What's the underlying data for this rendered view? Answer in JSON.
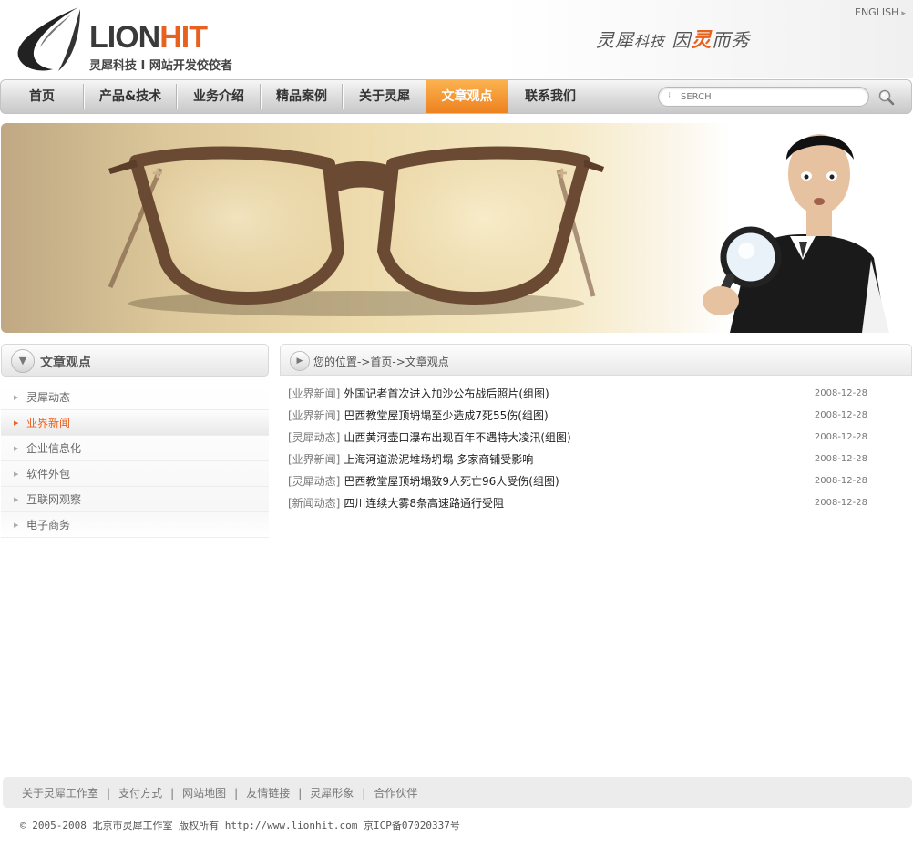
{
  "header": {
    "logo_text_1": "LION",
    "logo_text_2": "HIT",
    "logo_subtitle": "灵犀科技 I 网站开发佼佼者",
    "slogan_1": "灵犀",
    "slogan_2": "科技",
    "slogan_3": "因",
    "slogan_4": "灵",
    "slogan_5": "而秀",
    "lang_link": "ENGLISH",
    "lang_arrow": "▸"
  },
  "nav": {
    "items": [
      {
        "label": "首页"
      },
      {
        "label": "产品&技术"
      },
      {
        "label": "业务介绍"
      },
      {
        "label": "精品案例"
      },
      {
        "label": "关于灵犀"
      },
      {
        "label": "文章观点"
      },
      {
        "label": "联系我们"
      }
    ],
    "active_index": 5,
    "search_placeholder": "SERCH",
    "search_icon": "magnifier-icon"
  },
  "sidebar": {
    "title": "文章观点",
    "header_icon": "triangle-down-icon",
    "items": [
      {
        "label": "灵犀动态"
      },
      {
        "label": "业界新闻"
      },
      {
        "label": "企业信息化"
      },
      {
        "label": "软件外包"
      },
      {
        "label": "互联网观察"
      },
      {
        "label": "电子商务"
      }
    ],
    "active_index": 1
  },
  "main": {
    "breadcrumb": "您的位置->首页->文章观点",
    "articles": [
      {
        "category": "[业界新闻]",
        "title": "外国记者首次进入加沙公布战后照片(组图)",
        "date": "2008-12-28"
      },
      {
        "category": "[业界新闻]",
        "title": "巴西教堂屋顶坍塌至少造成7死55伤(组图)",
        "date": "2008-12-28"
      },
      {
        "category": "[灵犀动态]",
        "title": "山西黄河壶口瀑布出现百年不遇特大凌汛(组图)",
        "date": "2008-12-28"
      },
      {
        "category": "[业界新闻]",
        "title": "上海河道淤泥堆场坍塌 多家商铺受影响",
        "date": "2008-12-28"
      },
      {
        "category": "[灵犀动态]",
        "title": "巴西教堂屋顶坍塌致9人死亡96人受伤(组图)",
        "date": "2008-12-28"
      },
      {
        "category": "[新闻动态]",
        "title": "四川连续大雾8条高速路通行受阻",
        "date": "2008-12-28"
      }
    ]
  },
  "footer": {
    "links": [
      "关于灵犀工作室",
      "支付方式",
      "网站地图",
      "友情链接",
      "灵犀形象",
      "合作伙伴"
    ],
    "separator": "|",
    "copyright": "© 2005-2008 北京市灵犀工作室 版权所有 http://www.lionhit.com 京ICP备07020337号"
  },
  "colors": {
    "accent": "#e8611f",
    "nav_active": "#f49b34"
  }
}
